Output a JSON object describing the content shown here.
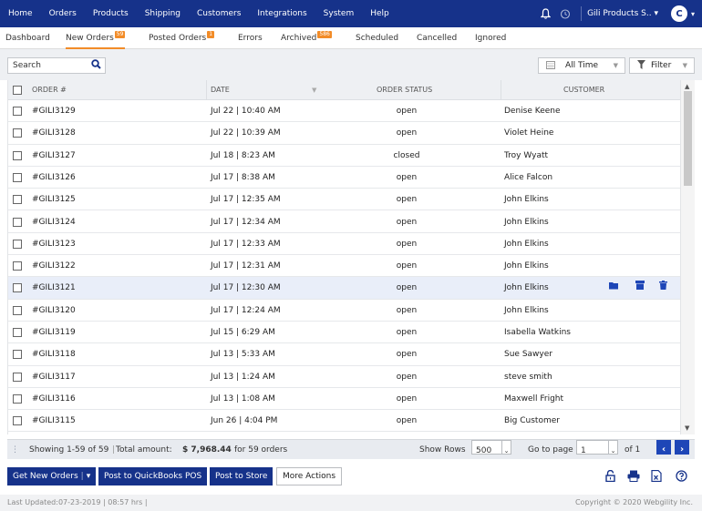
{
  "topnav": {
    "menu": [
      "Home",
      "Orders",
      "Products",
      "Shipping",
      "Customers",
      "Integrations",
      "System",
      "Help"
    ],
    "store_name": "Gili Products S..",
    "avatar_letter": "C"
  },
  "tabs": [
    {
      "label": "Dashboard",
      "badge": ""
    },
    {
      "label": "New Orders",
      "badge": "59"
    },
    {
      "label": "Posted Orders",
      "badge": "1"
    },
    {
      "label": "Errors",
      "badge": ""
    },
    {
      "label": "Archived",
      "badge": "586"
    },
    {
      "label": "Scheduled",
      "badge": ""
    },
    {
      "label": "Cancelled",
      "badge": ""
    },
    {
      "label": "Ignored",
      "badge": ""
    }
  ],
  "toolbar": {
    "search_placeholder": "Search",
    "date_filter": "All Time",
    "filter_label": "Filter"
  },
  "table": {
    "columns": {
      "order": "ORDER #",
      "date": "DATE",
      "status": "ORDER STATUS",
      "customer": "CUSTOMER"
    },
    "rows": [
      {
        "order": "#GILI3129",
        "date": "Jul 22 | 10:40 AM",
        "status": "open",
        "customer": "Denise Keene"
      },
      {
        "order": "#GILI3128",
        "date": "Jul 22 | 10:39 AM",
        "status": "open",
        "customer": "Violet Heine"
      },
      {
        "order": "#GILI3127",
        "date": "Jul 18 | 8:23 AM",
        "status": "closed",
        "customer": "Troy Wyatt"
      },
      {
        "order": "#GILI3126",
        "date": "Jul 17 | 8:38 AM",
        "status": "open",
        "customer": "Alice Falcon"
      },
      {
        "order": "#GILI3125",
        "date": "Jul 17 | 12:35 AM",
        "status": "open",
        "customer": "John Elkins"
      },
      {
        "order": "#GILI3124",
        "date": "Jul 17 | 12:34 AM",
        "status": "open",
        "customer": "John Elkins"
      },
      {
        "order": "#GILI3123",
        "date": "Jul 17 | 12:33 AM",
        "status": "open",
        "customer": "John Elkins"
      },
      {
        "order": "#GILI3122",
        "date": "Jul 17 | 12:31 AM",
        "status": "open",
        "customer": "John Elkins"
      },
      {
        "order": "#GILI3121",
        "date": "Jul 17 | 12:30 AM",
        "status": "open",
        "customer": "John Elkins"
      },
      {
        "order": "#GILI3120",
        "date": "Jul 17 | 12:24 AM",
        "status": "open",
        "customer": "John Elkins"
      },
      {
        "order": "#GILI3119",
        "date": "Jul 15 | 6:29 AM",
        "status": "open",
        "customer": "Isabella Watkins"
      },
      {
        "order": "#GILI3118",
        "date": "Jul 13 | 5:33 AM",
        "status": "open",
        "customer": "Sue Sawyer"
      },
      {
        "order": "#GILI3117",
        "date": "Jul 13 | 1:24 AM",
        "status": "open",
        "customer": "steve smith"
      },
      {
        "order": "#GILI3116",
        "date": "Jul 13 | 1:08 AM",
        "status": "open",
        "customer": "Maxwell Fright"
      },
      {
        "order": "#GILI3115",
        "date": "Jun 26 | 4:04 PM",
        "status": "open",
        "customer": "Big Customer"
      }
    ]
  },
  "footer": {
    "showing": "Showing 1-59 of 59",
    "total_label": "Total amount:",
    "total_amount": "$ 7,968.44",
    "for_orders": "for 59 orders",
    "show_rows_label": "Show Rows",
    "show_rows_value": "500",
    "go_to_page_label": "Go to page",
    "page_value": "1",
    "of_pages": "of 1"
  },
  "actions": {
    "get_new_orders": "Get New Orders",
    "post_qb": "Post to QuickBooks POS",
    "post_store": "Post to Store",
    "more_actions": "More Actions"
  },
  "status": {
    "last_updated": "Last Updated:07-23-2019 | 08:57 hrs |",
    "copyright": "Copyright © 2020 Webgility Inc."
  },
  "colors": {
    "nav": "#16328a",
    "accent": "#f28c28",
    "highlight_row": "#e9eef9"
  }
}
